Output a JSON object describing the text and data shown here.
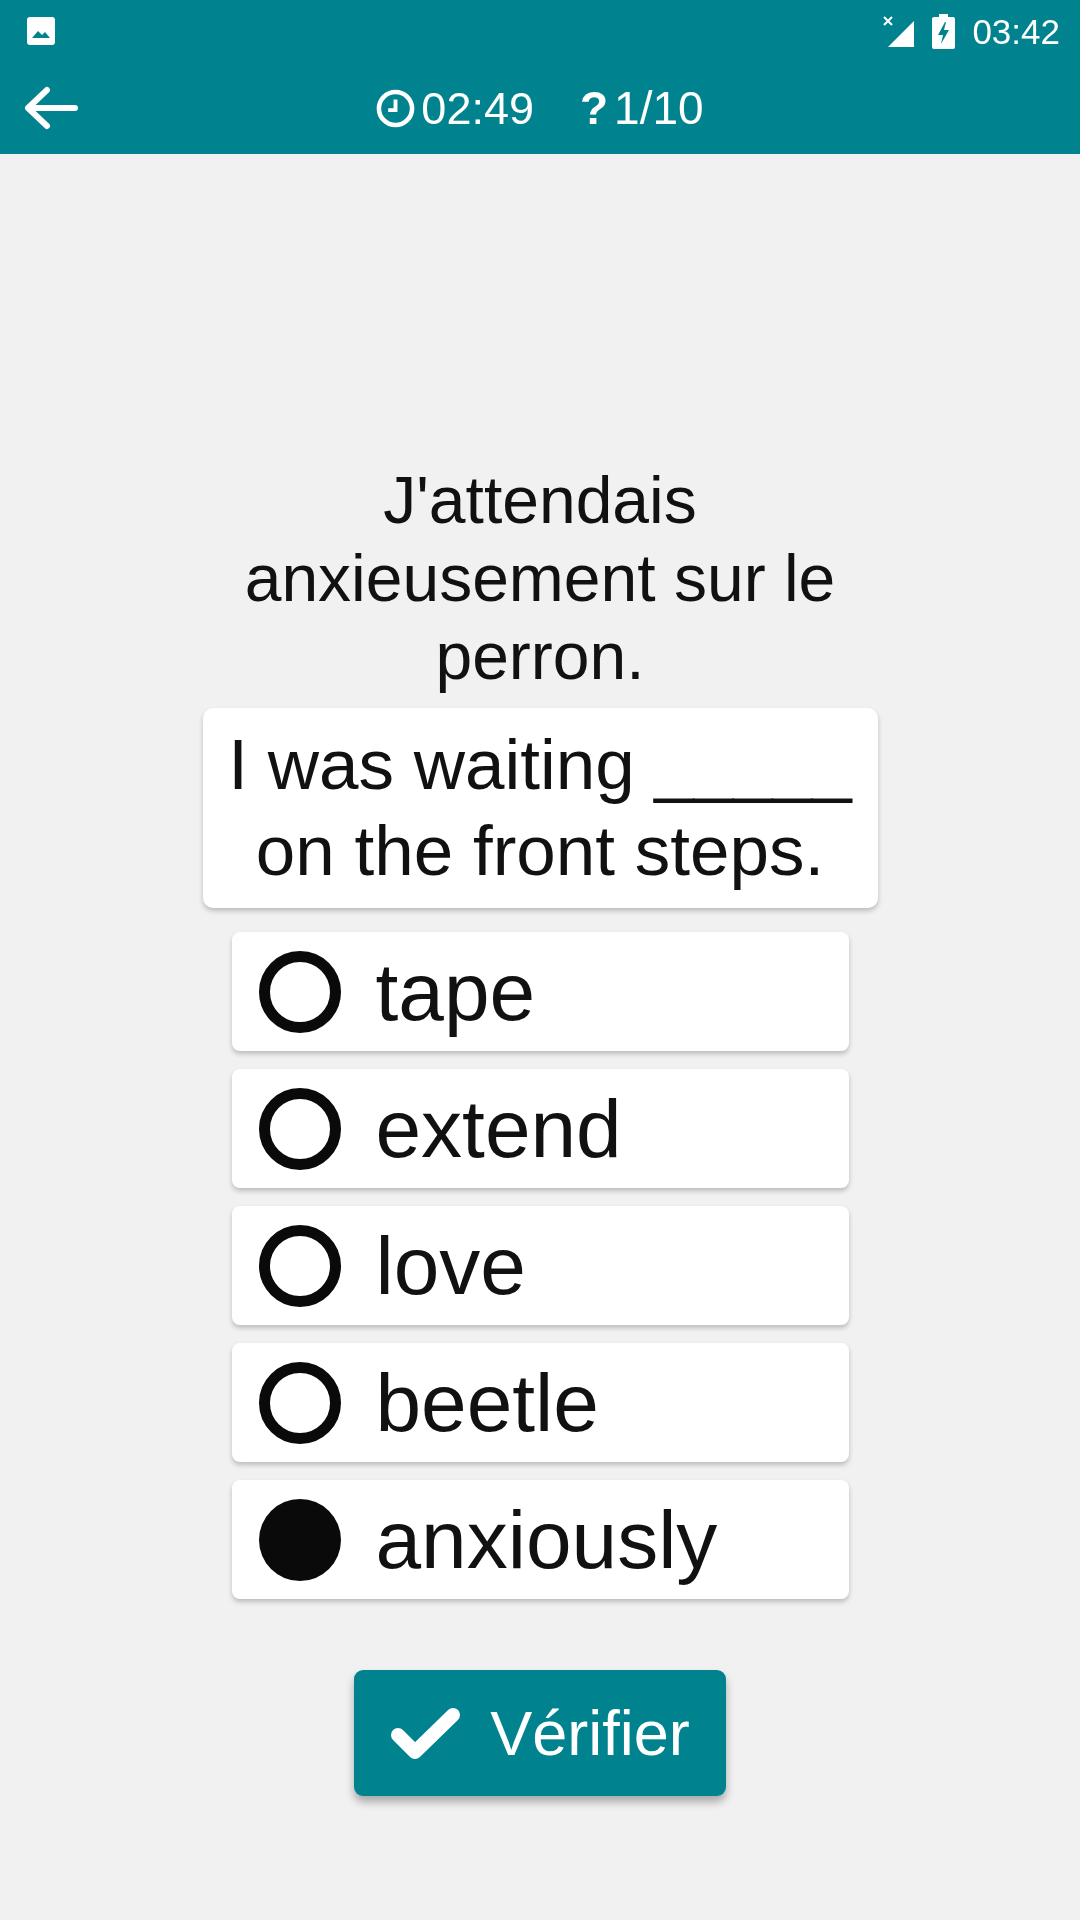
{
  "status_bar": {
    "time": "03:42"
  },
  "toolbar": {
    "timer": "02:49",
    "question_glyph": "?",
    "progress": "1/10"
  },
  "question": {
    "prompt": "J'attendais anxieusement sur le perron.",
    "sentence": "I was waiting _____ on the front steps."
  },
  "options": [
    {
      "label": "tape",
      "selected": false
    },
    {
      "label": "extend",
      "selected": false
    },
    {
      "label": "love",
      "selected": false
    },
    {
      "label": "beetle",
      "selected": false
    },
    {
      "label": "anxiously",
      "selected": true
    }
  ],
  "check_button": {
    "label": "Vérifier"
  }
}
